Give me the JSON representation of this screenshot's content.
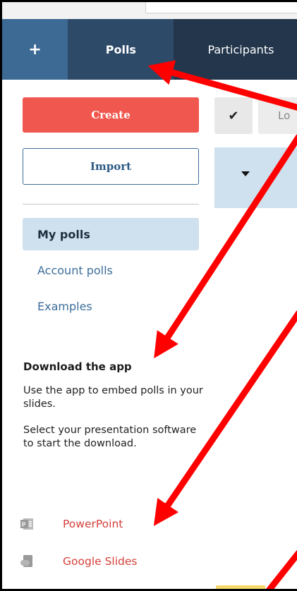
{
  "nav": {
    "plus_label": "+",
    "tabs": [
      {
        "label": "Polls"
      },
      {
        "label": "Participants"
      }
    ]
  },
  "sidebar": {
    "create_label": "Create",
    "import_label": "Import",
    "items": [
      {
        "label": "My polls"
      },
      {
        "label": "Account polls"
      },
      {
        "label": "Examples"
      }
    ]
  },
  "download": {
    "title": "Download the app",
    "text1": "Use the app to embed polls in your slides.",
    "text2": "Select your presentation software to start the download.",
    "apps": [
      {
        "label": "PowerPoint",
        "icon": "powerpoint-icon"
      },
      {
        "label": "Google Slides",
        "icon": "google-slides-icon"
      }
    ]
  },
  "toolbar": {
    "lock_label": "Lo",
    "check_glyph": "✔"
  },
  "colors": {
    "nav_bg": "#23364c",
    "plus_bg": "#3c6a94",
    "polls_tab_bg": "#2d4a68",
    "create_bg": "#f0574e",
    "accent_blue": "#3d6e9a",
    "active_item_bg": "#cfe0ee",
    "link_red": "#d5403a",
    "annotation_red": "#ff0000"
  }
}
